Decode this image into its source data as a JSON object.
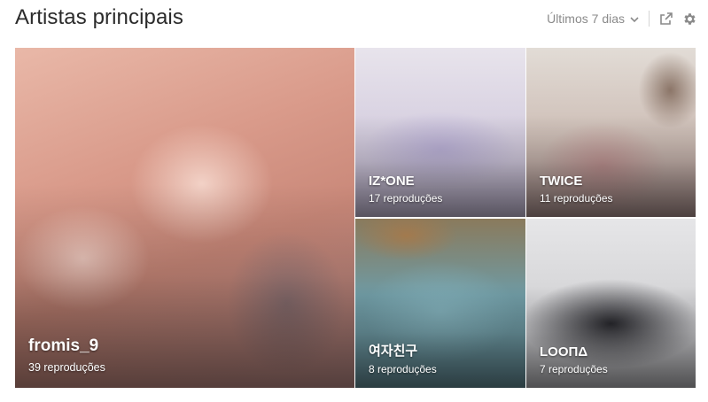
{
  "header": {
    "title": "Artistas principais",
    "range_label": "Últimos 7 dias"
  },
  "icons": {
    "range": "chevron-down-icon",
    "share": "share-icon",
    "settings": "gear-icon"
  },
  "artists": [
    {
      "name": "fromis_9",
      "plays": "39 reproduções"
    },
    {
      "name": "IZ*ONE",
      "plays": "17 reproduções"
    },
    {
      "name": "TWICE",
      "plays": "11 reproduções"
    },
    {
      "name": "여자친구",
      "plays": "8 reproduções"
    },
    {
      "name": "LOOΠΔ",
      "plays": "7 reproduções"
    }
  ],
  "colors": {
    "title": "#2b2b2b",
    "muted": "#8a8a8a",
    "tile_text": "#ffffff"
  }
}
